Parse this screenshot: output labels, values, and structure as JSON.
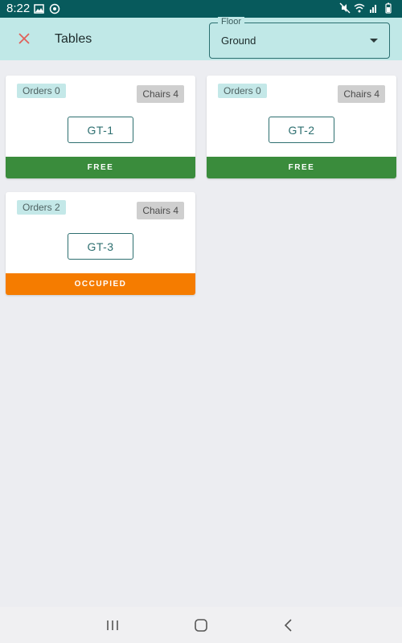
{
  "status_bar": {
    "time": "8:22",
    "background": "#075a5c"
  },
  "app_bar": {
    "title": "Tables",
    "close_icon": "close-icon",
    "floor_select": {
      "label": "Floor",
      "value": "Ground"
    }
  },
  "tables": [
    {
      "name": "GT-1",
      "orders_label": "Orders 0",
      "chairs_label": "Chairs 4",
      "status": "FREE",
      "status_color": "#3a8c3c"
    },
    {
      "name": "GT-2",
      "orders_label": "Orders 0",
      "chairs_label": "Chairs 4",
      "status": "FREE",
      "status_color": "#3a8c3c"
    },
    {
      "name": "GT-3",
      "orders_label": "Orders 2",
      "chairs_label": "Chairs 4",
      "status": "OCCUPIED",
      "status_color": "#f57c00"
    }
  ],
  "nav_bar": {
    "icons": [
      "recent-apps-icon",
      "home-icon",
      "back-icon"
    ]
  }
}
